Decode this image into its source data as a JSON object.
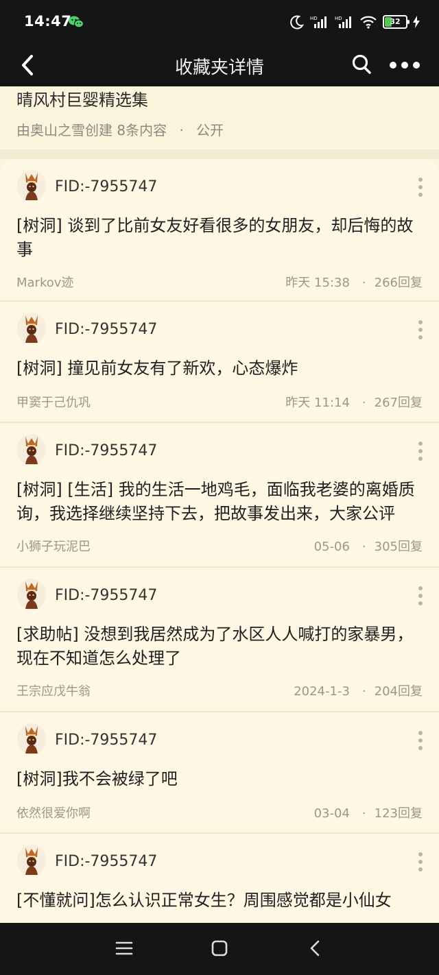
{
  "status": {
    "time": "14:47",
    "battery": "32"
  },
  "nav": {
    "title": "收藏夹详情"
  },
  "collection": {
    "title": "晴风村巨婴精选集",
    "creator": "由奥山之雪创建",
    "count": "8条内容",
    "dot": "·",
    "visibility": "公开"
  },
  "posts": [
    {
      "user": "FID:-7955747",
      "title": "[树洞] 谈到了比前女友好看很多的女朋友，却后悔的故事",
      "author": "Markov迹",
      "time": "昨天  15:38",
      "dot": "·",
      "replies": "266回复"
    },
    {
      "user": "FID:-7955747",
      "title": "[树洞] 撞见前女友有了新欢，心态爆炸",
      "author": "甲窦于己仇巩",
      "time": "昨天  11:14",
      "dot": "·",
      "replies": "267回复"
    },
    {
      "user": "FID:-7955747",
      "title": "[树洞] [生活] 我的生活一地鸡毛，面临我老婆的离婚质询，我选择继续坚持下去，把故事发出来，大家公评",
      "author": "小狮子玩泥巴",
      "time": "05-06",
      "dot": "·",
      "replies": "305回复"
    },
    {
      "user": "FID:-7955747",
      "title": "[求助帖] 没想到我居然成为了水区人人喊打的家暴男，现在不知道怎么处理了",
      "author": "王宗应戊牛翁",
      "time": "2024-1-3",
      "dot": "·",
      "replies": "204回复"
    },
    {
      "user": "FID:-7955747",
      "title": "[树洞]我不会被绿了吧",
      "author": "依然很爱你啊",
      "time": "03-04",
      "dot": "·",
      "replies": "123回复"
    },
    {
      "user": "FID:-7955747",
      "title": "[不懂就问]怎么认识正常女生？周围感觉都是小仙女",
      "author": "",
      "time": "",
      "dot": "",
      "replies": ""
    }
  ]
}
